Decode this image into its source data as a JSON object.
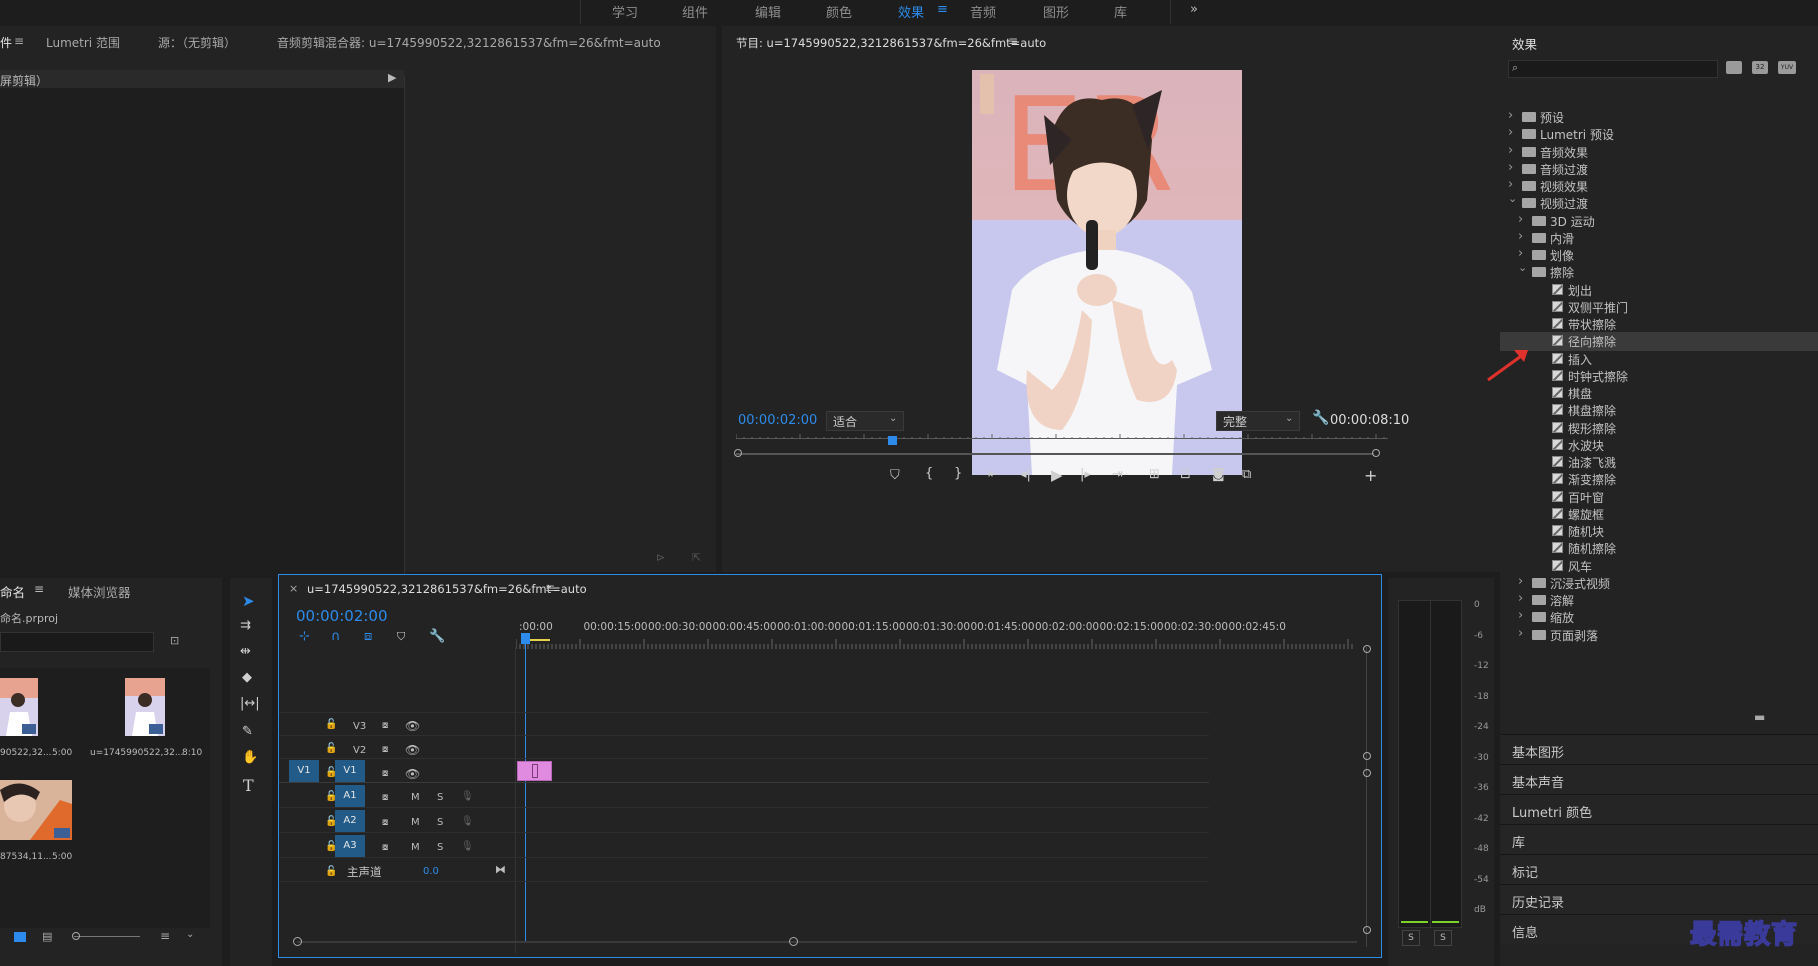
{
  "workspaces": [
    "学习",
    "组件",
    "编辑",
    "颜色",
    "效果",
    "音频",
    "图形",
    "库"
  ],
  "workspaces_more": "»",
  "source_panel": {
    "tabs": [
      "件",
      "Lumetri 范围",
      "源：（无剪辑）",
      "音频剪辑混合器: u=1745990522,3212861537&fm=26&fmt=auto"
    ],
    "menu_icon": "≡",
    "dropdown": "屏剪辑）"
  },
  "program_panel": {
    "title": "节目: u=1745990522,3212861537&fm=26&fmt=auto",
    "menu_icon": "≡",
    "timecode": "00:00:02:00",
    "fit": "适合",
    "quality": "完整",
    "duration": "00:00:08:10",
    "playhead_progress": 0.24
  },
  "project_panel": {
    "tabs": [
      "命名",
      "媒体浏览器"
    ],
    "menu_icon": "≡",
    "file": "命名.prproj",
    "items": [
      {
        "name": "90522,32...",
        "duration": "5:00"
      },
      {
        "name": "u=1745990522,32...",
        "duration": "8:10"
      },
      {
        "name": "87534,11...",
        "duration": "5:00"
      }
    ]
  },
  "timeline": {
    "close": "×",
    "title": "u=1745990522,3212861537&fm=26&fmt=auto",
    "menu_icon": "≡",
    "timecode": "00:00:02:00",
    "ruler": [
      ":00:00",
      "00:00:15:00",
      "00:00:30:00",
      "00:00:45:00",
      "00:01:00:00",
      "00:01:15:00",
      "00:01:30:00",
      "00:01:45:00",
      "00:02:00:00",
      "00:02:15:00",
      "00:02:30:00",
      "00:02:45:0"
    ],
    "video_tracks": [
      "V3",
      "V2",
      "V1"
    ],
    "audio_tracks": [
      "A1",
      "A2",
      "A3"
    ],
    "source_patch_v": "V1",
    "master": "主声道",
    "master_value": "0.0",
    "mute": "M",
    "solo": "S"
  },
  "meter": {
    "labels": [
      "0",
      "-6",
      "-12",
      "-18",
      "-24",
      "-30",
      "-36",
      "-42",
      "-48",
      "-54",
      "dB"
    ],
    "solo": [
      "S",
      "S"
    ]
  },
  "effects": {
    "title": "效果",
    "search_placeholder": "",
    "buttons": [
      "32",
      "YUV"
    ],
    "tree": [
      {
        "label": "预设",
        "level": 0,
        "type": "preset",
        "open": false
      },
      {
        "label": "Lumetri 预设",
        "level": 0,
        "type": "preset",
        "open": false
      },
      {
        "label": "音频效果",
        "level": 0,
        "type": "folder",
        "open": false
      },
      {
        "label": "音频过渡",
        "level": 0,
        "type": "folder",
        "open": false
      },
      {
        "label": "视频效果",
        "level": 0,
        "type": "folder",
        "open": false
      },
      {
        "label": "视频过渡",
        "level": 0,
        "type": "folder",
        "open": true
      },
      {
        "label": "3D 运动",
        "level": 1,
        "type": "folder",
        "open": false
      },
      {
        "label": "内滑",
        "level": 1,
        "type": "folder",
        "open": false
      },
      {
        "label": "划像",
        "level": 1,
        "type": "folder",
        "open": false
      },
      {
        "label": "擦除",
        "level": 1,
        "type": "folder",
        "open": true
      },
      {
        "label": "划出",
        "level": 2,
        "type": "fx"
      },
      {
        "label": "双侧平推门",
        "level": 2,
        "type": "fx"
      },
      {
        "label": "带状擦除",
        "level": 2,
        "type": "fx"
      },
      {
        "label": "径向擦除",
        "level": 2,
        "type": "fx",
        "selected": true
      },
      {
        "label": "插入",
        "level": 2,
        "type": "fx"
      },
      {
        "label": "时钟式擦除",
        "level": 2,
        "type": "fx"
      },
      {
        "label": "棋盘",
        "level": 2,
        "type": "fx"
      },
      {
        "label": "棋盘擦除",
        "level": 2,
        "type": "fx"
      },
      {
        "label": "楔形擦除",
        "level": 2,
        "type": "fx"
      },
      {
        "label": "水波块",
        "level": 2,
        "type": "fx"
      },
      {
        "label": "油漆飞溅",
        "level": 2,
        "type": "fx"
      },
      {
        "label": "渐变擦除",
        "level": 2,
        "type": "fx"
      },
      {
        "label": "百叶窗",
        "level": 2,
        "type": "fx"
      },
      {
        "label": "螺旋框",
        "level": 2,
        "type": "fx"
      },
      {
        "label": "随机块",
        "level": 2,
        "type": "fx"
      },
      {
        "label": "随机擦除",
        "level": 2,
        "type": "fx"
      },
      {
        "label": "风车",
        "level": 2,
        "type": "fx"
      },
      {
        "label": "沉浸式视频",
        "level": 1,
        "type": "folder",
        "open": false
      },
      {
        "label": "溶解",
        "level": 1,
        "type": "folder",
        "open": false
      },
      {
        "label": "缩放",
        "level": 1,
        "type": "folder",
        "open": false
      },
      {
        "label": "页面剥落",
        "level": 1,
        "type": "folder",
        "open": false
      }
    ],
    "sections": [
      "基本图形",
      "基本声音",
      "Lumetri 颜色",
      "库",
      "标记",
      "历史记录",
      "信息"
    ]
  },
  "watermark": "最需教育",
  "colors": {
    "accent": "#2d8ceb",
    "track_blue": "#225b88",
    "clip": "#e18be0",
    "annotation": "#e0322c",
    "meter_green": "#7bd32a"
  }
}
